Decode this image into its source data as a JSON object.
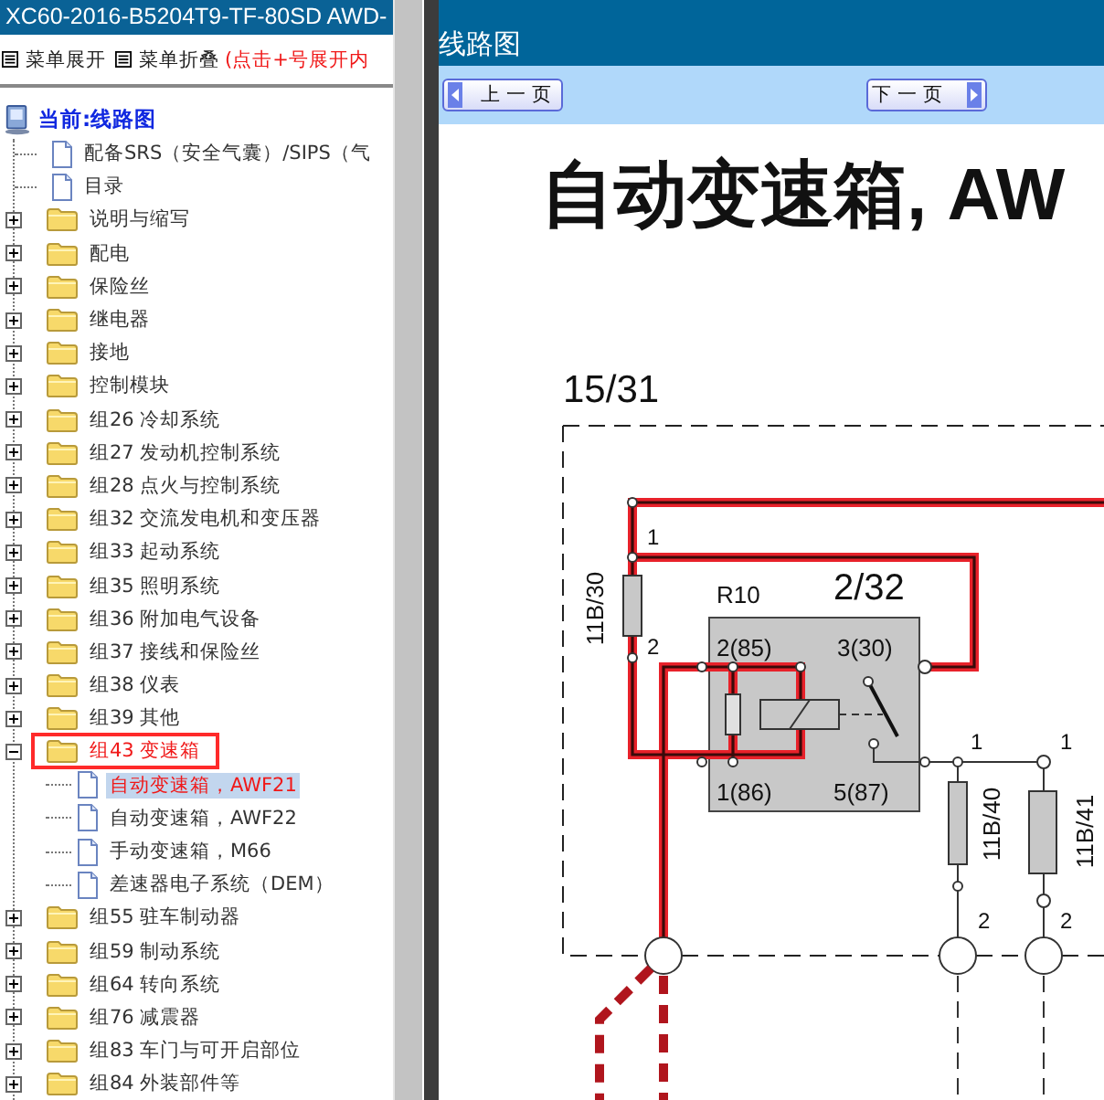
{
  "left_panel": {
    "title": "XC60-2016-B5204T9-TF-80SD AWD-",
    "menu": [
      {
        "label": "菜单展开"
      },
      {
        "label": "菜单折叠"
      }
    ],
    "hint": "(点击+号展开内",
    "tree": {
      "root": "当前:线路图",
      "items": [
        {
          "label": "配备SRS（安全气囊）/SIPS（气",
          "kind": "page"
        },
        {
          "label": "目录",
          "kind": "page"
        },
        {
          "label": "说明与缩写",
          "kind": "folder",
          "expanded": false
        },
        {
          "label": "配电",
          "kind": "folder",
          "expanded": false
        },
        {
          "label": "保险丝",
          "kind": "folder",
          "expanded": false
        },
        {
          "label": "继电器",
          "kind": "folder",
          "expanded": false
        },
        {
          "label": "接地",
          "kind": "folder",
          "expanded": false
        },
        {
          "label": "控制模块",
          "kind": "folder",
          "expanded": false
        },
        {
          "label": "组26 冷却系统",
          "kind": "folder",
          "expanded": false
        },
        {
          "label": "组27 发动机控制系统",
          "kind": "folder",
          "expanded": false
        },
        {
          "label": "组28 点火与控制系统",
          "kind": "folder",
          "expanded": false
        },
        {
          "label": "组32 交流发电机和变压器",
          "kind": "folder",
          "expanded": false
        },
        {
          "label": "组33 起动系统",
          "kind": "folder",
          "expanded": false
        },
        {
          "label": "组35 照明系统",
          "kind": "folder",
          "expanded": false
        },
        {
          "label": "组36 附加电气设备",
          "kind": "folder",
          "expanded": false
        },
        {
          "label": "组37 接线和保险丝",
          "kind": "folder",
          "expanded": false
        },
        {
          "label": "组38 仪表",
          "kind": "folder",
          "expanded": false
        },
        {
          "label": "组39 其他",
          "kind": "folder",
          "expanded": false
        },
        {
          "label": "组43 变速箱",
          "kind": "folder",
          "expanded": true,
          "children": [
            {
              "label": "自动变速箱，AWF21",
              "selected": true
            },
            {
              "label": "自动变速箱，AWF22",
              "selected": false
            },
            {
              "label": "手动变速箱，M66",
              "selected": false
            },
            {
              "label": "差速器电子系统（DEM）",
              "selected": false
            }
          ]
        },
        {
          "label": "组55 驻车制动器",
          "kind": "folder",
          "expanded": false
        },
        {
          "label": "组59 制动系统",
          "kind": "folder",
          "expanded": false
        },
        {
          "label": "组64 转向系统",
          "kind": "folder",
          "expanded": false
        },
        {
          "label": "组76 减震器",
          "kind": "folder",
          "expanded": false
        },
        {
          "label": "组83 车门与可开启部位",
          "kind": "folder",
          "expanded": false
        },
        {
          "label": "组84 外装部件等",
          "kind": "folder",
          "expanded": false
        }
      ]
    }
  },
  "right_panel": {
    "title": "线路图",
    "prev_button": "上一页",
    "next_button": "下一页",
    "diagram": {
      "heading": "自动变速箱, AW",
      "labels": [
        "15/31",
        "1",
        "2",
        "11B/30",
        "R10",
        "2/32",
        "2(85)",
        "3(30)",
        "1(86)",
        "5(87)",
        "1",
        "1",
        "11B/40",
        "2",
        "11B/41",
        "2"
      ]
    }
  }
}
